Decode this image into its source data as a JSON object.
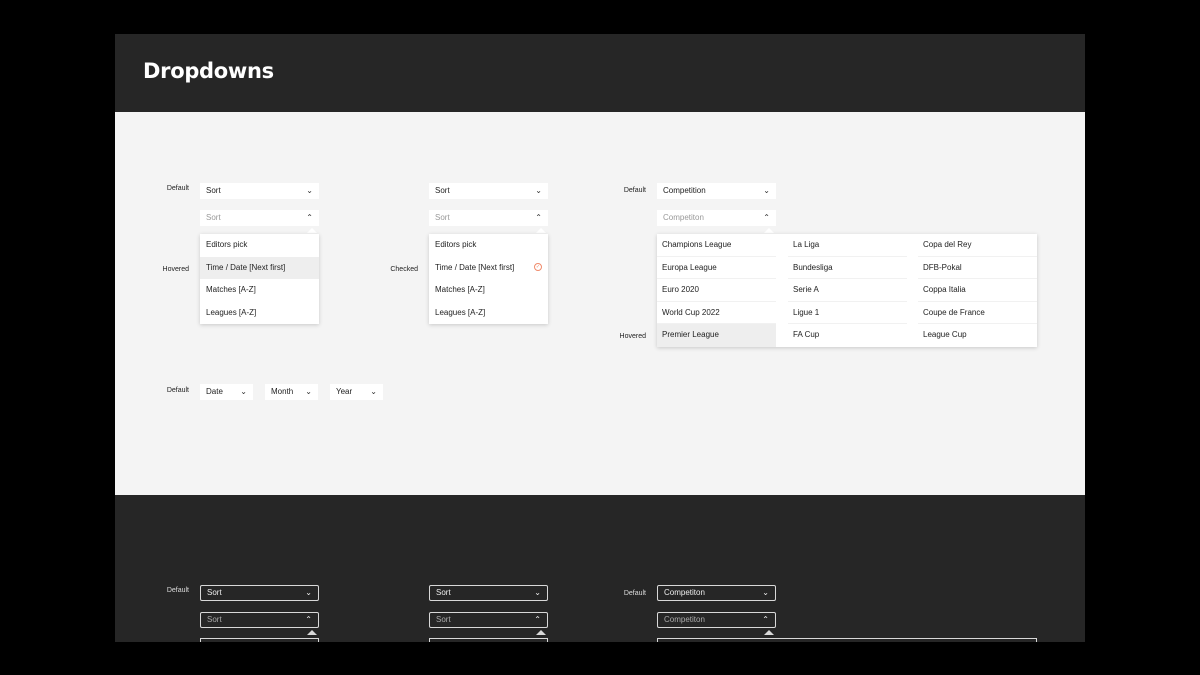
{
  "page": {
    "title": "Dropdowns"
  },
  "labels": {
    "default": "Default",
    "hovered": "Hovered",
    "checked": "Checked"
  },
  "sort": {
    "label": "Sort",
    "placeholder": "Sort",
    "options": [
      "Editors pick",
      "Time / Date [Next first]",
      "Matches [A-Z]",
      "Leagues [A-Z]"
    ],
    "hovered_index": 1,
    "checked_index": 1
  },
  "competition": {
    "label": "Competition",
    "placeholder": "Competiton",
    "dark_label": "Competiton",
    "columns": [
      [
        "Champions League",
        "Europa League",
        "Euro 2020",
        "World Cup 2022",
        "Premier League"
      ],
      [
        "La Liga",
        "Bundesliga",
        "Serie A",
        "Ligue 1",
        "FA Cup"
      ],
      [
        "Copa del Rey",
        "DFB-Pokal",
        "Coppa Italia",
        "Coupe de France",
        "League Cup"
      ]
    ],
    "hovered": "Premier League"
  },
  "date": {
    "date": "Date",
    "month": "Month",
    "year": "Year"
  },
  "icons": {
    "chevron_down": "chevron-down-icon",
    "chevron_up": "chevron-up-icon",
    "check": "check-circle-icon"
  },
  "colors": {
    "header_bg": "#262626",
    "canvas_bg": "#f4f4f4",
    "accent": "#f08a6a"
  }
}
